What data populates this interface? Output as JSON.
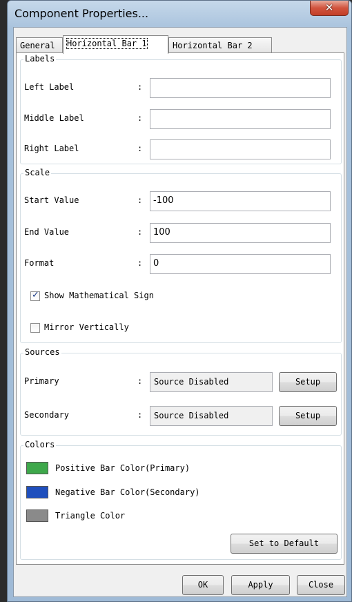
{
  "window": {
    "title": "Component Properties..."
  },
  "tabs": [
    {
      "label": "General"
    },
    {
      "label": "Horizontal Bar 1"
    },
    {
      "label": "Horizontal Bar 2"
    }
  ],
  "labels_group": {
    "title": "Labels",
    "left_label": "Left Label",
    "left_value": "",
    "middle_label": "Middle Label",
    "middle_value": "",
    "right_label": "Right Label",
    "right_value": "",
    "colon": ":"
  },
  "scale_group": {
    "title": "Scale",
    "start_label": "Start Value",
    "start_value": "-100",
    "end_label": "End Value",
    "end_value": "100",
    "format_label": "Format",
    "format_value": "0",
    "show_sign_label": "Show Mathematical Sign",
    "show_sign_checked": true,
    "mirror_label": "Mirror Vertically",
    "mirror_checked": false
  },
  "sources_group": {
    "title": "Sources",
    "primary_label": "Primary",
    "primary_value": "Source Disabled",
    "secondary_label": "Secondary",
    "secondary_value": "Source Disabled",
    "setup_label": "Setup"
  },
  "colors_group": {
    "title": "Colors",
    "positive_label": "Positive Bar Color(Primary)",
    "positive_color": "#3ea84b",
    "negative_label": "Negative Bar Color(Secondary)",
    "negative_color": "#1f4fbd",
    "triangle_label": "Triangle Color",
    "triangle_color": "#8a8a8a",
    "default_button": "Set to Default"
  },
  "footer": {
    "ok": "OK",
    "apply": "Apply",
    "close": "Close"
  }
}
